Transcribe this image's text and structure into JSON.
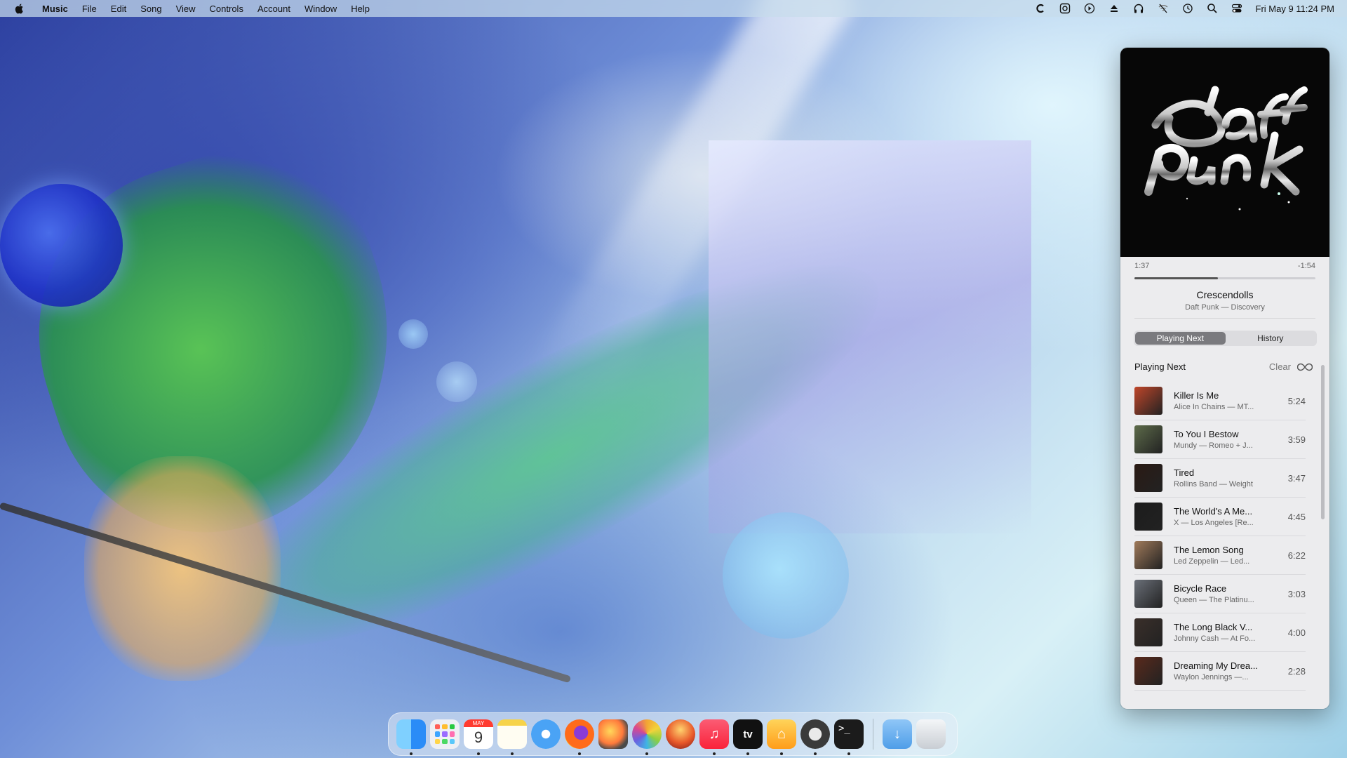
{
  "menubar": {
    "app_name": "Music",
    "menus": [
      "File",
      "Edit",
      "Song",
      "View",
      "Controls",
      "Account",
      "Window",
      "Help"
    ],
    "status_icons": [
      "cmd-c-icon",
      "app-icon",
      "play-circle-icon",
      "eject-icon",
      "headphones-icon",
      "wifi-off-icon",
      "time-machine-icon",
      "search-icon",
      "control-center-icon"
    ],
    "clock": "Fri May 9  11:24 PM"
  },
  "player": {
    "album_art": "Daft Punk Discovery album art",
    "elapsed": "1:37",
    "remaining": "-1:54",
    "progress": 0.46,
    "track": {
      "title": "Crescendolls",
      "subtitle": "Daft Punk — Discovery"
    },
    "tabs": [
      {
        "label": "Playing Next",
        "active": true
      },
      {
        "label": "History",
        "active": false
      }
    ],
    "queue_title": "Playing Next",
    "clear_label": "Clear",
    "queue": [
      {
        "title": "Killer Is Me",
        "subtitle": "Alice In Chains — MT...",
        "duration": "5:24",
        "color": "#c0462a"
      },
      {
        "title": "To You I Bestow",
        "subtitle": "Mundy — Romeo + J...",
        "duration": "3:59",
        "color": "#5d6b4a"
      },
      {
        "title": "Tired",
        "subtitle": "Rollins Band — Weight",
        "duration": "3:47",
        "color": "#2a1a14"
      },
      {
        "title": "The World's A Me...",
        "subtitle": "X — Los Angeles [Re...",
        "duration": "4:45",
        "color": "#1c1c1c"
      },
      {
        "title": "The Lemon Song",
        "subtitle": "Led Zeppelin — Led...",
        "duration": "6:22",
        "color": "#a07a5a"
      },
      {
        "title": "Bicycle Race",
        "subtitle": "Queen — The Platinu...",
        "duration": "3:03",
        "color": "#6a6f78"
      },
      {
        "title": "The Long Black V...",
        "subtitle": "Johnny Cash — At Fo...",
        "duration": "4:00",
        "color": "#3a2f2a"
      },
      {
        "title": "Dreaming My Drea...",
        "subtitle": "Waylon Jennings —...",
        "duration": "2:28",
        "color": "#5a2a1c"
      }
    ]
  },
  "dock": {
    "apps": [
      {
        "name": "finder-app",
        "class": "ic-finder",
        "running": true
      },
      {
        "name": "launchpad-app",
        "class": "ic-launchpad",
        "running": false
      },
      {
        "name": "calendar-app",
        "class": "ic-calendar",
        "running": true,
        "month": "MAY",
        "day": "9"
      },
      {
        "name": "notes-app",
        "class": "ic-notes",
        "running": true
      },
      {
        "name": "safari-app",
        "class": "ic-safari",
        "running": false
      },
      {
        "name": "firefox-app",
        "class": "ic-firefox",
        "running": true
      },
      {
        "name": "pixelmator-app",
        "class": "ic-pixelmator",
        "running": false
      },
      {
        "name": "photos-app",
        "class": "ic-photos",
        "running": true
      },
      {
        "name": "orb-app",
        "class": "ic-orb",
        "running": false
      },
      {
        "name": "music-app",
        "class": "ic-music",
        "running": true,
        "glyph": "♫"
      },
      {
        "name": "apple-tv-app",
        "class": "ic-tv",
        "running": true,
        "glyph": "tv"
      },
      {
        "name": "home-app",
        "class": "ic-home",
        "running": true,
        "glyph": "⌂"
      },
      {
        "name": "chrome-app",
        "class": "ic-chrome",
        "running": true
      },
      {
        "name": "terminal-app",
        "class": "ic-terminal",
        "running": true,
        "glyph": ">_"
      }
    ],
    "stacks": [
      {
        "name": "downloads-folder",
        "class": "ic-downloads",
        "glyph": "↓"
      },
      {
        "name": "trash",
        "class": "ic-trash"
      }
    ]
  }
}
